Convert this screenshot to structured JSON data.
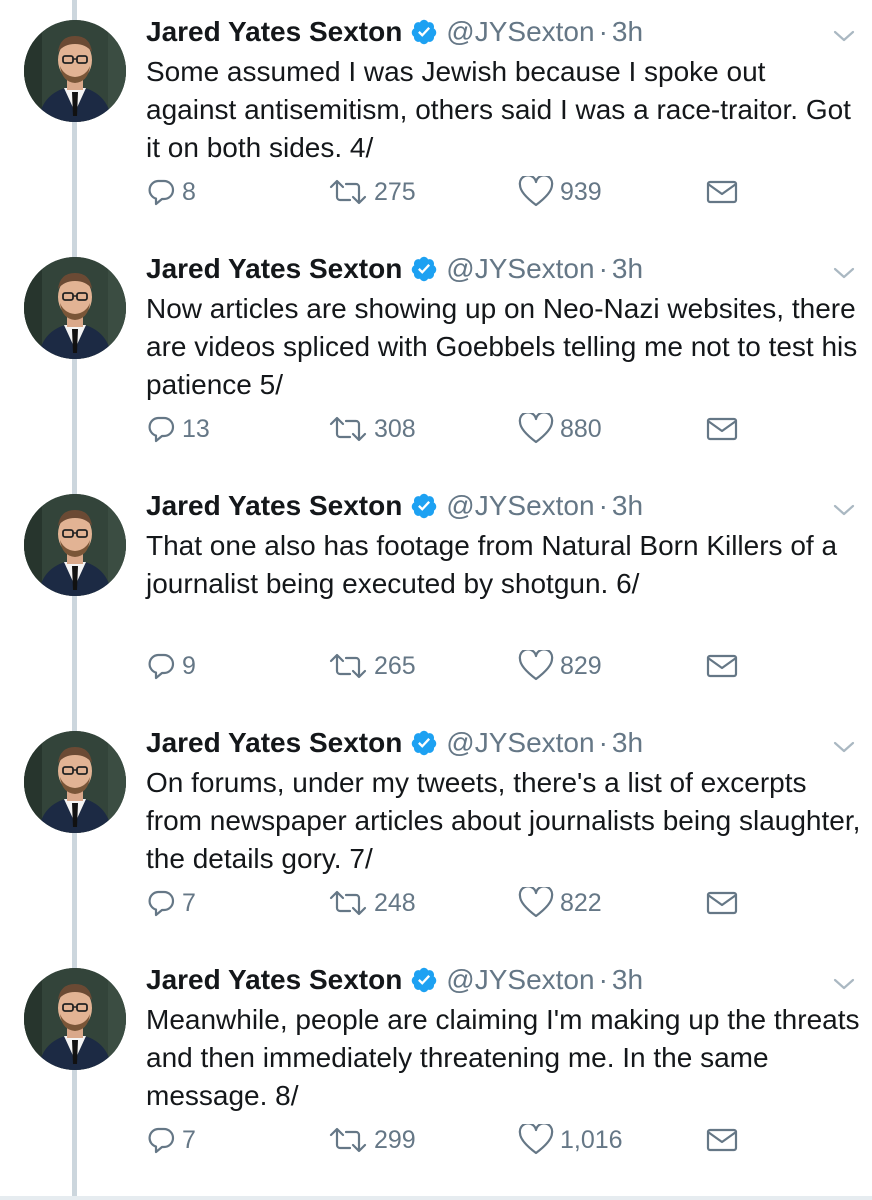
{
  "tweets": [
    {
      "name": "Jared Yates Sexton",
      "handle": "@JYSexton",
      "dot": "·",
      "time": "3h",
      "text": "Some assumed I was Jewish because I spoke out against antisemitism, others said I was a race-traitor. Got it on both sides. 4/",
      "replies": "8",
      "retweets": "275",
      "likes": "939"
    },
    {
      "name": "Jared Yates Sexton",
      "handle": "@JYSexton",
      "dot": "·",
      "time": "3h",
      "text": "Now articles are showing up on Neo-Nazi websites, there are videos spliced with Goebbels telling me not to test his patience 5/",
      "replies": "13",
      "retweets": "308",
      "likes": "880"
    },
    {
      "name": "Jared Yates Sexton",
      "handle": "@JYSexton",
      "dot": "·",
      "time": "3h",
      "text": "That one also has footage from Natural Born Killers of a journalist being executed by shotgun. 6/",
      "replies": "9",
      "retweets": "265",
      "likes": "829"
    },
    {
      "name": "Jared Yates Sexton",
      "handle": "@JYSexton",
      "dot": "·",
      "time": "3h",
      "text": "On forums, under my tweets, there's a list of excerpts from newspaper articles about journalists being slaughter, the details gory. 7/",
      "replies": "7",
      "retweets": "248",
      "likes": "822"
    },
    {
      "name": "Jared Yates Sexton",
      "handle": "@JYSexton",
      "dot": "·",
      "time": "3h",
      "text": "Meanwhile, people are claiming I'm making up the threats and then immediately threatening me. In the same message. 8/",
      "replies": "7",
      "retweets": "299",
      "likes": "1,016"
    }
  ],
  "colors": {
    "text": "#14171a",
    "secondary": "#657786",
    "verified": "#1da1f2",
    "thread_line": "#ccd6dd"
  },
  "icons": {
    "verified": "verified-badge-icon",
    "chevron": "chevron-down-icon",
    "reply": "reply-icon",
    "retweet": "retweet-icon",
    "like": "heart-icon",
    "dm": "envelope-icon"
  }
}
